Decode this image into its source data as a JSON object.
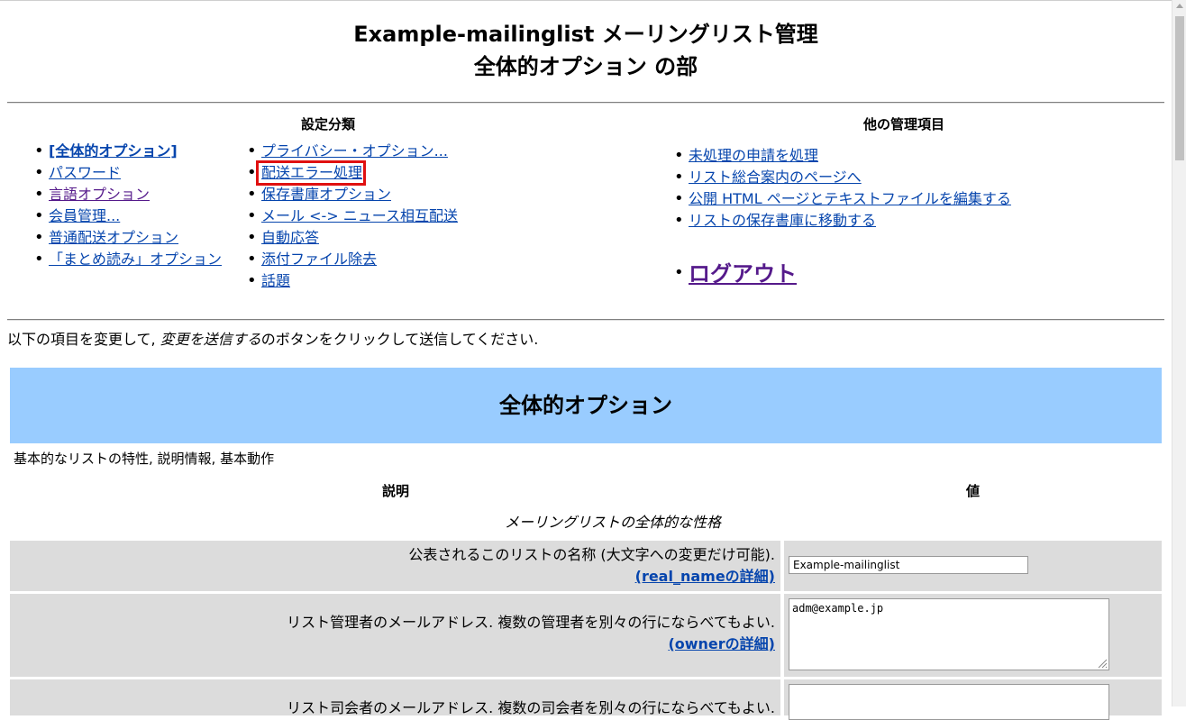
{
  "header": {
    "title_line1": "Example-mailinglist メーリングリスト管理",
    "title_line2": "全体的オプション の部"
  },
  "categories": {
    "heading": "設定分類",
    "col1": [
      "[全体的オプション]",
      "パスワード",
      "言語オプション",
      "会員管理...",
      "普通配送オプション",
      "「まとめ読み」オプション"
    ],
    "col2": [
      "プライバシー・オプション...",
      "配送エラー処理",
      "保存書庫オプション",
      "メール <-> ニュース相互配送",
      "自動応答",
      "添付ファイル除去",
      "話題"
    ]
  },
  "other": {
    "heading": "他の管理項目",
    "items": [
      "未処理の申請を処理",
      "リスト総合案内のページへ",
      "公開 HTML ページとテキストファイルを編集する",
      "リストの保存書庫に移動する"
    ],
    "logout": "ログアウト"
  },
  "instructions": {
    "before": "以下の項目を変更して, ",
    "em": "変更を送信する",
    "after": "のボタンをクリックして送信してください."
  },
  "section": {
    "banner": "全体的オプション",
    "description": "基本的なリストの特性, 説明情報, 基本動作",
    "col_desc": "説明",
    "col_val": "値",
    "group_title": "メーリングリストの全体的な性格"
  },
  "rows": [
    {
      "label": "公表されるこのリストの名称 (大文字への変更だけ可能).",
      "detail_link": "(real_nameの詳細)",
      "value": "Example-mailinglist"
    },
    {
      "label": "リスト管理者のメールアドレス. 複数の管理者を別々の行にならべてもよい.",
      "detail_link": "(ownerの詳細)",
      "value": "adm@example.jp"
    },
    {
      "label": "リスト司会者のメールアドレス. 複数の司会者を別々の行にならべてもよい.",
      "detail_link": "",
      "value": ""
    }
  ],
  "colors": {
    "link": "#0645ad",
    "visited": "#551a8b",
    "banner_bg": "#99ccff",
    "row_bg": "#dcdcdc",
    "highlight": "#e01010"
  }
}
